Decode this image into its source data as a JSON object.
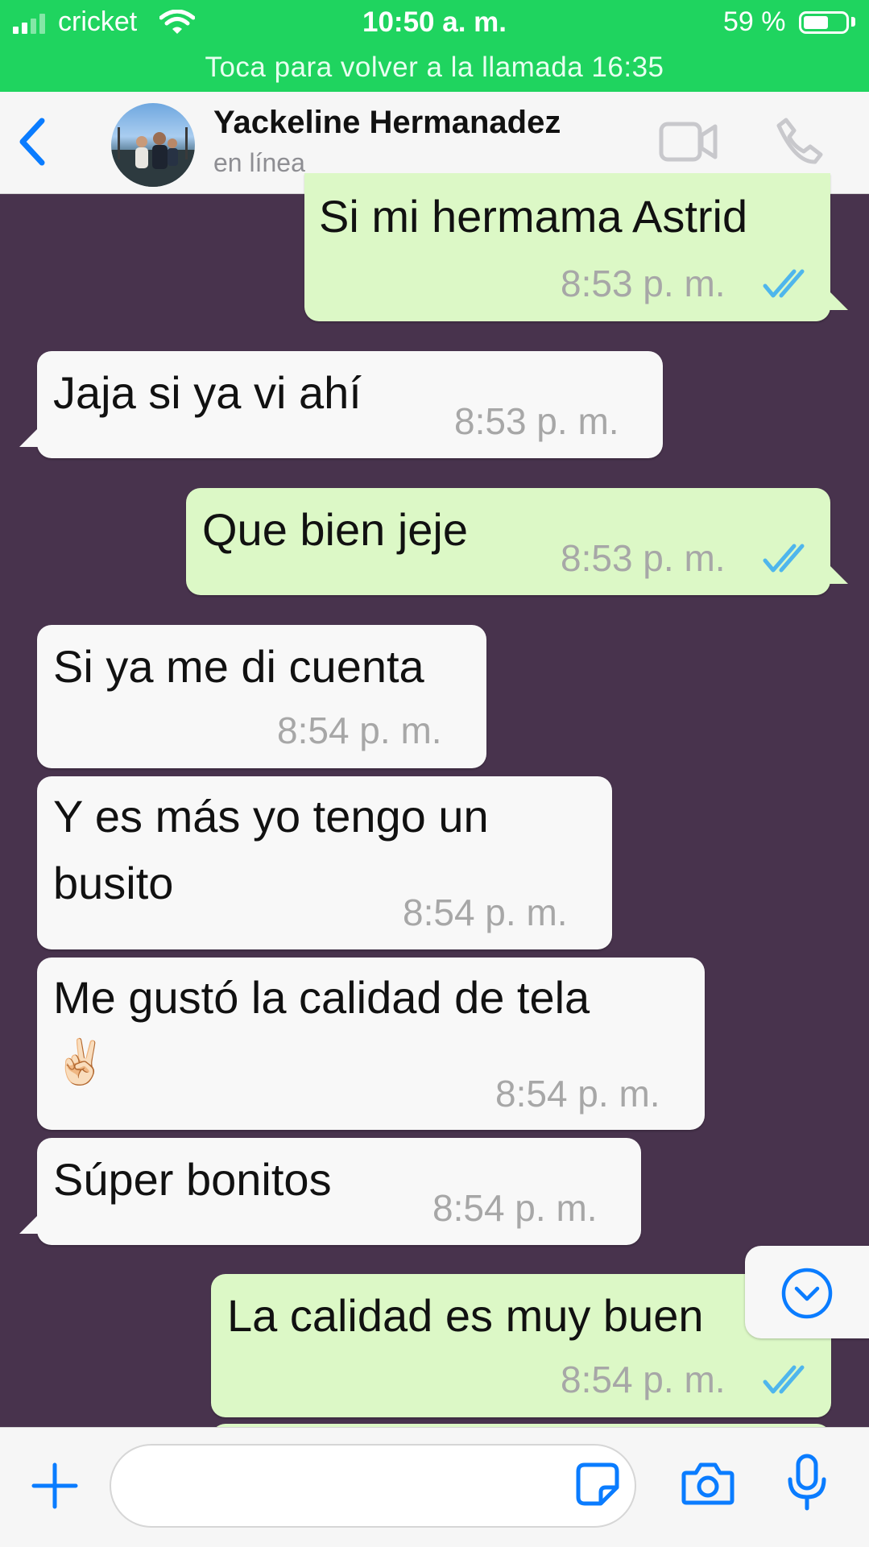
{
  "status_bar": {
    "carrier": "cricket",
    "time": "10:50 a. m.",
    "battery": "59 %",
    "battery_level": 0.59,
    "call_banner": "Toca para volver a la llamada 16:35"
  },
  "header": {
    "contact_name": "Yackeline Hermanadez",
    "status": "en línea",
    "icons": [
      "back-chevron-icon",
      "video-call-icon",
      "phone-call-icon"
    ]
  },
  "messages": [
    {
      "dir": "out",
      "text": "Si mi hermama Astrid",
      "time": "8:53 p. m.",
      "read": true
    },
    {
      "dir": "in",
      "text": "Jaja si ya vi ahí",
      "time": "8:53 p. m."
    },
    {
      "dir": "out",
      "text": "Que bien jeje",
      "time": "8:53 p. m.",
      "read": true
    },
    {
      "dir": "in",
      "text": "Si ya me di cuenta",
      "time": "8:54 p. m."
    },
    {
      "dir": "in",
      "line1": "Y es más yo tengo un",
      "line2": "busito",
      "time": "8:54 p. m."
    },
    {
      "dir": "in",
      "line1": "Me gustó la calidad de tela",
      "line2": "✌🏻",
      "time": "8:54 p. m."
    },
    {
      "dir": "in",
      "text": "Súper bonitos",
      "time": "8:54 p. m."
    },
    {
      "dir": "out",
      "text": "La calidad es muy buen",
      "time": "8:54 p. m.",
      "read": true
    }
  ],
  "colors": {
    "status_green": "#1fd45f",
    "chat_bg": "#48334d",
    "outgoing_bubble": "#dcf8c6",
    "incoming_bubble": "#f8f8f8",
    "accent_blue": "#0a7cff",
    "read_ticks": "#4fb6ec"
  },
  "input_bar": {
    "value": "",
    "icons": [
      "plus-icon",
      "sticker-icon",
      "camera-icon",
      "microphone-icon"
    ]
  }
}
